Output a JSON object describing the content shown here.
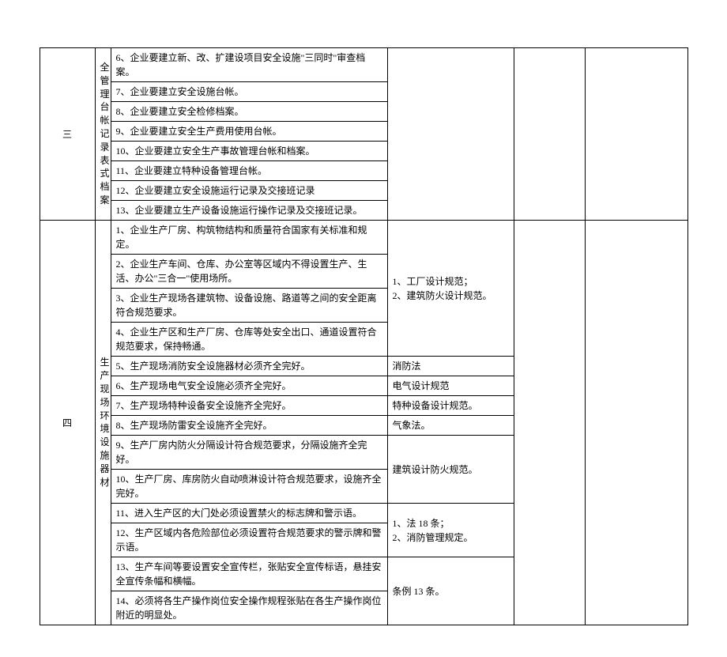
{
  "sections": [
    {
      "index": "三",
      "category": "全管理台帐记录表式档案",
      "items": [
        {
          "text": "6、企业要建立新、改、扩建设项目安全设施\"三同时\"审查档案。",
          "ref": ""
        },
        {
          "text": "7、企业要建立安全设施台帐。",
          "ref": ""
        },
        {
          "text": "8、企业要建立安全检修档案。",
          "ref": ""
        },
        {
          "text": "9、企业要建立安全生产费用使用台帐。",
          "ref": ""
        },
        {
          "text": "10、企业要建立安全生产事故管理台帐和档案。",
          "ref": ""
        },
        {
          "text": "11、企业要建立特种设备管理台帐。",
          "ref": ""
        },
        {
          "text": "12、企业要建立安全设施运行记录及交接班记录",
          "ref": ""
        },
        {
          "text": "13、企业要建立生产设备设施运行操作记录及交接班记录。",
          "ref": ""
        }
      ],
      "section_ref": ""
    },
    {
      "index": "四",
      "category": "生产现场环境设施器材",
      "items": [
        {
          "text": "1、企业生产厂房、构筑物结构和质量符合国家有关标准和规定。"
        },
        {
          "text": "2、企业生产车间、仓库、办公室等区域内不得设置生产、生活、办公\"三合一\"使用场所。"
        },
        {
          "text": "3、企业生产现场各建筑物、设备设施、路道等之间的安全距离符合规范要求。"
        },
        {
          "text": "4、企业生产区和生产厂房、仓库等处安全出口、通道设置符合规范要求，保持畅通。"
        },
        {
          "text": "5、生产现场消防安全设施器材必须齐全完好。",
          "ref": "消防法"
        },
        {
          "text": "6、生产现场电气安全设施必须齐全完好。",
          "ref": "电气设计规范"
        },
        {
          "text": "7、生产现场特种设备安全设施齐全完好。",
          "ref": "特种设备设计规范。"
        },
        {
          "text": "8、生产现场防雷安全设施齐全完好。",
          "ref": "气象法。"
        },
        {
          "text": "9、生产厂房内防火分隔设计符合规范要求，分隔设施齐全完好。"
        },
        {
          "text": "10、生产厂房、库房防火自动喷淋设计符合规范要求，设施齐全完好。"
        },
        {
          "text": "11、进入生产区的大门处必须设置禁火的标志牌和警示语。"
        },
        {
          "text": "12、生产区域内各危险部位必须设置符合规范要求的警示牌和警示语。"
        },
        {
          "text": "13、生产车间等要设置安全宣传栏，张贴安全宣传标语，悬挂安全宣传条幅和横幅。"
        },
        {
          "text": "14、必须将各生产操作岗位安全操作规程张贴在各生产操作岗位附近的明显处。"
        }
      ],
      "group_refs": [
        {
          "rows": "1-4",
          "text": "1、工厂设计规范；\n2、建筑防火设计规范。"
        },
        {
          "rows": "9-10",
          "text": "建筑设计防火规范。"
        },
        {
          "rows": "11-12",
          "text": "1、法 18 条；\n2、消防管理规定。"
        },
        {
          "rows": "13-14",
          "text": "条例 13 条。"
        }
      ]
    }
  ]
}
